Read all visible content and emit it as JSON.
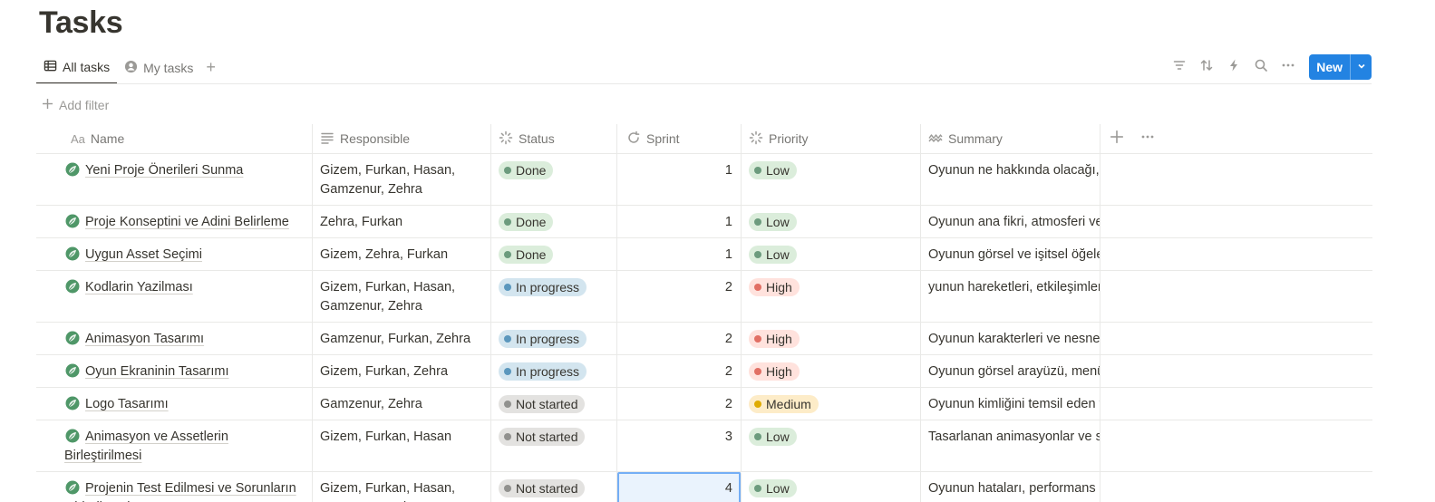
{
  "page_title": "Tasks",
  "views": [
    {
      "label": "All tasks",
      "icon": "table-icon",
      "active": true
    },
    {
      "label": "My tasks",
      "icon": "person-icon",
      "active": false
    }
  ],
  "add_view_label": "+",
  "toolbar": {
    "icons": [
      "filter-icon",
      "sort-icon",
      "lightning-icon",
      "search-icon",
      "more-icon"
    ],
    "new_label": "New",
    "accent": "#2383e2"
  },
  "add_filter_label": "Add filter",
  "columns": {
    "name": "Name",
    "responsible": "Responsible",
    "status": "Status",
    "sprint": "Sprint",
    "priority": "Priority",
    "summary": "Summary"
  },
  "status_colors": {
    "Done": {
      "bg": "#dbeddb",
      "dot": "#6c9b7d"
    },
    "In progress": {
      "bg": "#d3e5ef",
      "dot": "#5b97bd"
    },
    "Not started": {
      "bg": "#e3e2e0",
      "dot": "#91918e"
    }
  },
  "priority_colors": {
    "Low": {
      "bg": "#dbeddb",
      "dot": "#6c9b7d"
    },
    "High": {
      "bg": "#ffe2dd",
      "dot": "#e16f64"
    },
    "Medium": {
      "bg": "#fdecc8",
      "dot": "#dfab01"
    }
  },
  "rows": [
    {
      "name": "Yeni Proje Önerileri Sunma",
      "responsible": "Gizem, Furkan, Hasan, Gamzenur, Zehra",
      "status": "Done",
      "sprint": "1",
      "priority": "Low",
      "summary": "Oyunun ne hakkında olacağı, n"
    },
    {
      "name": "Proje Konseptini ve Adini Belirleme",
      "responsible": "Zehra, Furkan",
      "status": "Done",
      "sprint": "1",
      "priority": "Low",
      "summary": "Oyunun ana fikri, atmosferi ve"
    },
    {
      "name": " Uygun Asset Seçimi",
      "responsible": "Gizem, Zehra, Furkan",
      "status": "Done",
      "sprint": "1",
      "priority": "Low",
      "summary": "Oyunun görsel ve işitsel öğele"
    },
    {
      "name": "Kodlarin Yazilması",
      "responsible": "Gizem, Furkan, Hasan, Gamzenur, Zehra",
      "status": "In progress",
      "sprint": "2",
      "priority": "High",
      "summary": "yunun hareketleri, etkileşimler"
    },
    {
      "name": "Animasyon Tasarımı",
      "responsible": "Gamzenur, Furkan, Zehra",
      "status": "In progress",
      "sprint": "2",
      "priority": "High",
      "summary": "Oyunun karakterleri ve nesnel"
    },
    {
      "name": "Oyun Ekraninin Tasarımı",
      "responsible": "Gizem, Furkan, Zehra",
      "status": "In progress",
      "sprint": "2",
      "priority": "High",
      "summary": "Oyunun görsel arayüzü, menü"
    },
    {
      "name": "Logo Tasarımı",
      "responsible": "Gamzenur, Zehra",
      "status": "Not started",
      "sprint": "2",
      "priority": "Medium",
      "summary": "Oyunun kimliğini temsil eden v"
    },
    {
      "name": "Animasyon ve Assetlerin Birleştirilmesi",
      "responsible": "Gizem, Furkan, Hasan",
      "status": "Not started",
      "sprint": "3",
      "priority": "Low",
      "summary": "Tasarlanan animasyonlar ve se"
    },
    {
      "name": "Projenin Test Edilmesi ve Sorunların Giderilmesi",
      "responsible": "Gizem, Furkan, Hasan, Gamzenur, Zehra",
      "status": "Not started",
      "sprint": "4",
      "priority": "Low",
      "summary": "Oyunun hataları, performans s",
      "selected_cell": "sprint"
    }
  ]
}
